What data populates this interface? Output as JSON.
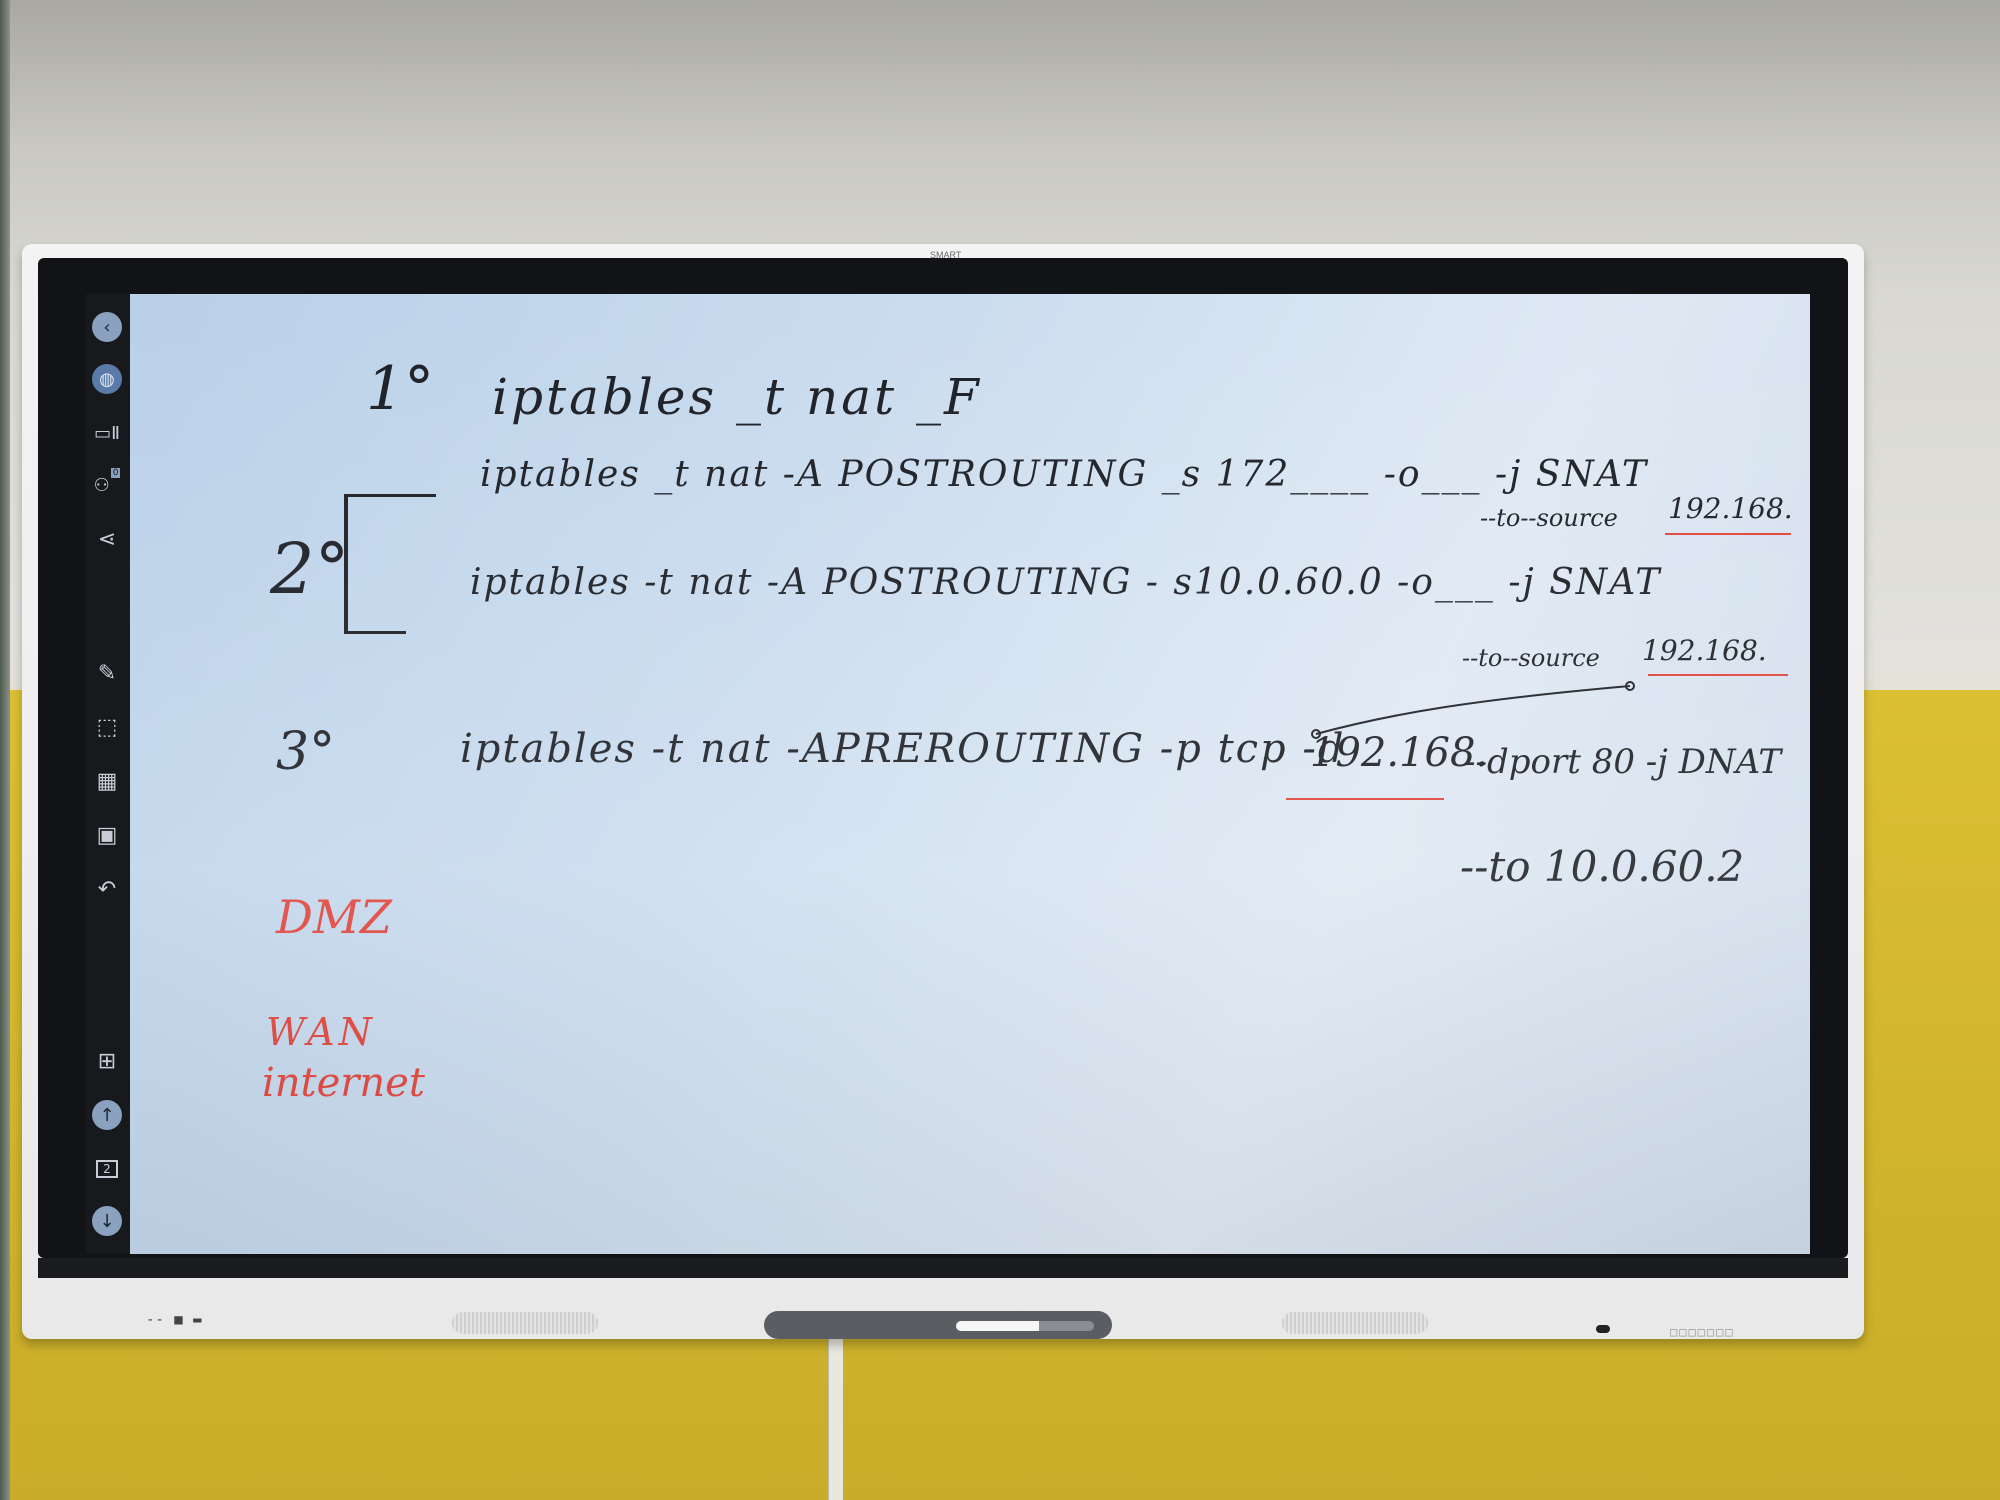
{
  "board": {
    "brand": "SMART",
    "port_labels": "-- ■ ▬",
    "control_labels": "□□□□□□□"
  },
  "toolbar": {
    "icons": [
      {
        "name": "back-icon",
        "glyph": "‹"
      },
      {
        "name": "browser-icon",
        "glyph": "◍"
      },
      {
        "name": "display-icon",
        "glyph": "▭Ⅱ"
      },
      {
        "name": "participants-icon",
        "glyph": "👥"
      },
      {
        "name": "share-icon",
        "glyph": "<"
      },
      {
        "name": "pen-icon",
        "glyph": "✎"
      },
      {
        "name": "select-icon",
        "glyph": "⬚"
      },
      {
        "name": "widgets-icon",
        "glyph": "▦"
      },
      {
        "name": "insert-image-icon",
        "glyph": "▣"
      },
      {
        "name": "undo-icon",
        "glyph": "↶"
      },
      {
        "name": "add-page-icon",
        "glyph": "⊞"
      },
      {
        "name": "page-up-icon",
        "glyph": "↑"
      },
      {
        "name": "page-counter-icon",
        "glyph": "2"
      },
      {
        "name": "page-down-icon",
        "glyph": "↓"
      }
    ],
    "participants_badge": "0",
    "page_number": "2"
  },
  "whiteboard": {
    "step1": {
      "label": "1°",
      "command": "iptables _t nat _F"
    },
    "step2": {
      "label": "2°",
      "line1": "iptables _t nat -A POSTROUTING _s 172____ -o___ -j SNAT",
      "line1_to": "--to--source",
      "line1_ip": "192.168.",
      "line2": "iptables -t nat -A POSTROUTING - s10.0.60.0 -o___ -j SNAT",
      "line2_to": "--to--source",
      "line2_ip": "192.168."
    },
    "step3": {
      "label": "3°",
      "command_a": "iptables -t nat -APREROUTING -p tcp -d",
      "ip": "192.168.",
      "command_b": "--dport 80 -j DNAT",
      "to": "--to 10.0.60.2"
    },
    "notes": {
      "dmz": "DMZ",
      "wan": "WAN",
      "internet": "internet"
    }
  },
  "colors": {
    "ink": "#1c1f25",
    "red_ink": "#e0433a",
    "screen": "#c9dbee",
    "toolbar": "#17191d",
    "wall_yellow": "#d2b52c"
  }
}
